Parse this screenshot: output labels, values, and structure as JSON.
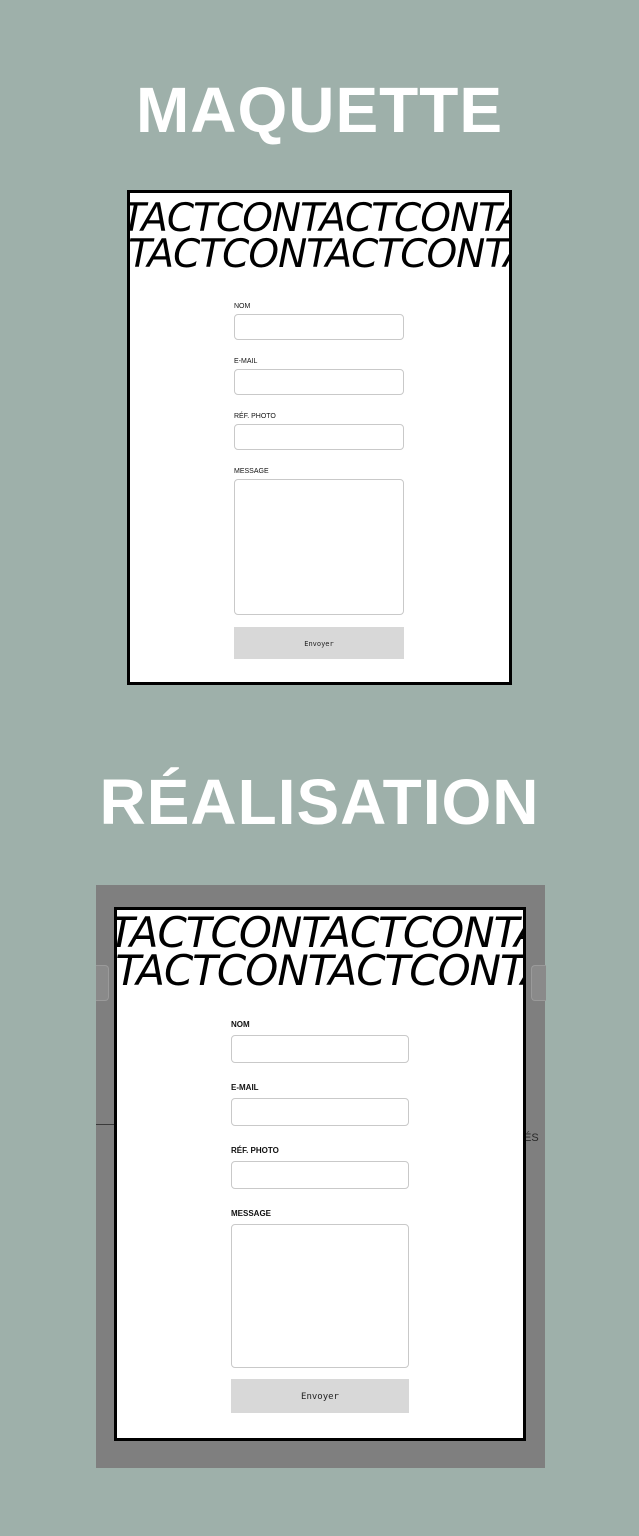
{
  "sections": {
    "mockup_title": "MAQUETTE",
    "realisation_title": "RÉALISATION"
  },
  "marquee": {
    "row1": "TACTCONTACTCONTACTCONTACT",
    "row2": "NTACTCONTACTCONTACTCONTACT"
  },
  "form": {
    "name_label": "NOM",
    "email_label": "E-MAIL",
    "photo_ref_label": "RÉF. PHOTO",
    "message_label": "MESSAGE",
    "submit_label": "Envoyer"
  },
  "background_partial_text": "ÉS",
  "colors": {
    "page_background": "#9eb0aa",
    "overlay": "#7f7f7f",
    "frame_border": "#000000",
    "button_background": "#d8d8d8"
  }
}
